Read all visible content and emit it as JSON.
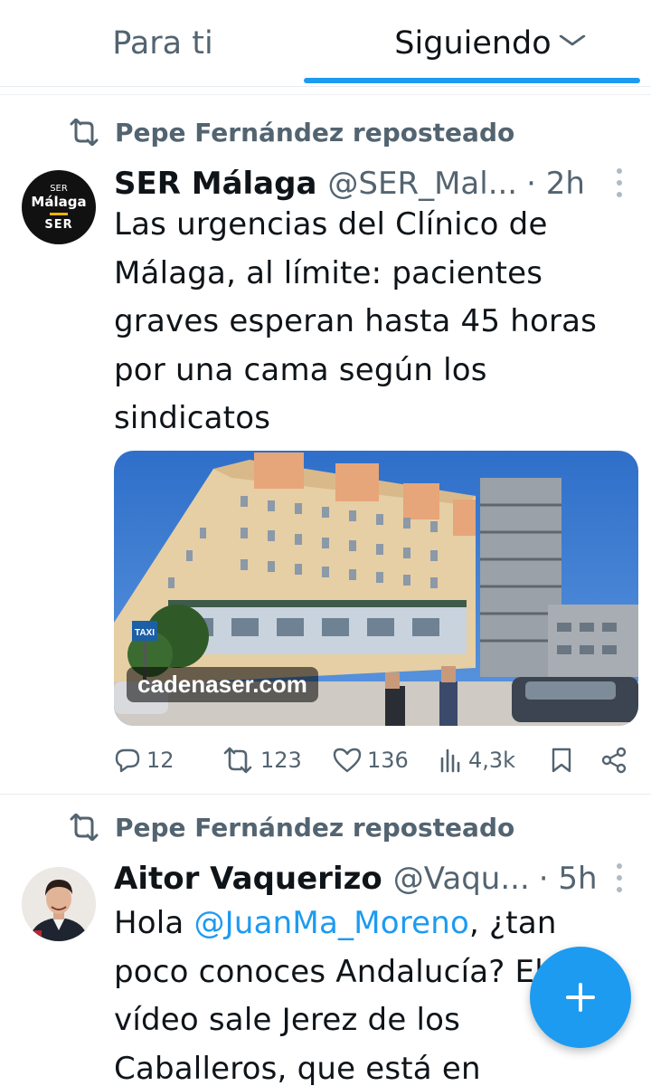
{
  "tabs": {
    "for_you": "Para ti",
    "following": "Siguiendo"
  },
  "tweets": [
    {
      "repost_label": "Pepe Fernández reposteado",
      "avatar": {
        "line1": "SER",
        "line2": "Málaga",
        "line3": "SER"
      },
      "name": "SER Málaga",
      "handle": "@SER_Mal...",
      "time": "· 2h",
      "lines": [
        "Las urgencias del Clínico de",
        "Málaga, al límite: pacientes",
        "graves esperan hasta 45 horas",
        "por una cama según los",
        "sindicatos"
      ],
      "media_caption": "cadenaser.com",
      "media_sign": "TAXI",
      "stats": {
        "replies": "12",
        "reposts": "123",
        "likes": "136",
        "views": "4,3k"
      }
    },
    {
      "repost_label": "Pepe Fernández reposteado",
      "name": "Aitor Vaquerizo",
      "handle": "@Vaqu...",
      "time": "· 5h",
      "text_prefix": "Hola ",
      "mention": "@JuanMa_Moreno",
      "text_suffix": ", ¿tan",
      "lines": [
        "poco conoces Andalucía? El",
        "vídeo sale Jerez de los",
        "Caballeros, que está en"
      ]
    }
  ],
  "colors": {
    "accent": "#1d9bf0",
    "secondary_text": "#536471"
  }
}
